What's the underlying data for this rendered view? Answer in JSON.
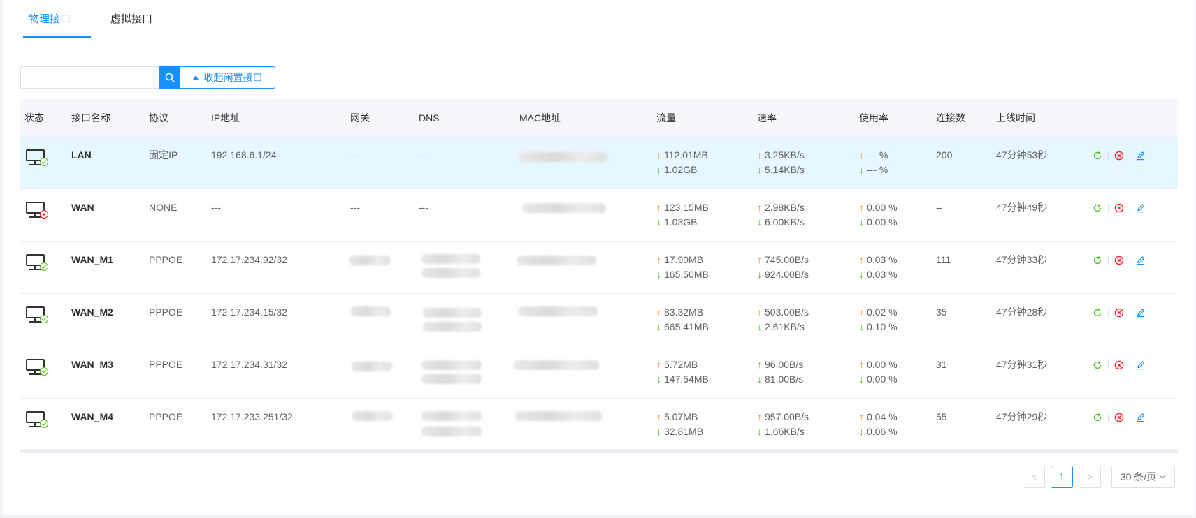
{
  "tabs": [
    {
      "label": "物理接口",
      "active": true
    },
    {
      "label": "虚拟接口",
      "active": false
    }
  ],
  "toolbar": {
    "search_value": "",
    "search_placeholder": "",
    "collapse_label": "收起闲置接口"
  },
  "table": {
    "columns": [
      "状态",
      "接口名称",
      "协议",
      "IP地址",
      "网关",
      "DNS",
      "MAC地址",
      "流量",
      "速率",
      "使用率",
      "连接数",
      "上线时间"
    ],
    "rows": [
      {
        "status": "up",
        "name": "LAN",
        "protocol": "固定IP",
        "ip": "192.168.6.1/24",
        "gateway": "---",
        "dns": "---",
        "traffic_up": "112.01MB",
        "traffic_down": "1.02GB",
        "rate_up": "3.25KB/s",
        "rate_down": "5.14KB/s",
        "usage_up": "--- %",
        "usage_down": "--- %",
        "connections": "200",
        "uptime": "47分钟53秒",
        "highlight": true
      },
      {
        "status": "down",
        "name": "WAN",
        "protocol": "NONE",
        "ip": "---",
        "gateway": "---",
        "dns": "---",
        "traffic_up": "123.15MB",
        "traffic_down": "1.03GB",
        "rate_up": "2.98KB/s",
        "rate_down": "6.00KB/s",
        "usage_up": "0.00 %",
        "usage_down": "0.00 %",
        "connections": "--",
        "uptime": "47分钟49秒",
        "highlight": false
      },
      {
        "status": "up",
        "name": "WAN_M1",
        "protocol": "PPPOE",
        "ip": "172.17.234.92/32",
        "gateway": "",
        "dns": "",
        "traffic_up": "17.90MB",
        "traffic_down": "165.50MB",
        "rate_up": "745.00B/s",
        "rate_down": "924.00B/s",
        "usage_up": "0.03 %",
        "usage_down": "0.03 %",
        "connections": "111",
        "uptime": "47分钟33秒",
        "highlight": false
      },
      {
        "status": "up",
        "name": "WAN_M2",
        "protocol": "PPPOE",
        "ip": "172.17.234.15/32",
        "gateway": "",
        "dns": "",
        "traffic_up": "83.32MB",
        "traffic_down": "665.41MB",
        "rate_up": "503.00B/s",
        "rate_down": "2.61KB/s",
        "usage_up": "0.02 %",
        "usage_down": "0.10 %",
        "connections": "35",
        "uptime": "47分钟28秒",
        "highlight": false
      },
      {
        "status": "up",
        "name": "WAN_M3",
        "protocol": "PPPOE",
        "ip": "172.17.234.31/32",
        "gateway": "",
        "dns": "",
        "traffic_up": "5.72MB",
        "traffic_down": "147.54MB",
        "rate_up": "96.00B/s",
        "rate_down": "81.00B/s",
        "usage_up": "0.00 %",
        "usage_down": "0.00 %",
        "connections": "31",
        "uptime": "47分钟31秒",
        "highlight": false
      },
      {
        "status": "up",
        "name": "WAN_M4",
        "protocol": "PPPOE",
        "ip": "172.17.233.251/32",
        "gateway": "",
        "dns": "",
        "traffic_up": "5.07MB",
        "traffic_down": "32.81MB",
        "rate_up": "957.00B/s",
        "rate_down": "1.66KB/s",
        "usage_up": "0.04 %",
        "usage_down": "0.06 %",
        "connections": "55",
        "uptime": "47分钟29秒",
        "highlight": false
      }
    ]
  },
  "icons": {
    "status": "monitor-icon",
    "refresh": "refresh-icon",
    "disconnect": "close-circle-icon",
    "edit": "edit-icon",
    "search": "search-icon"
  },
  "colors": {
    "accent": "#1890ff",
    "up_arrow": "#fa8c16",
    "down_arrow": "#52c41a",
    "status_ok": "#52c41a",
    "status_error": "#f5222d",
    "highlight_row": "#e6f7ff"
  },
  "pagination": {
    "prev": "<",
    "current": "1",
    "next": ">",
    "page_size": "30 条/页"
  }
}
